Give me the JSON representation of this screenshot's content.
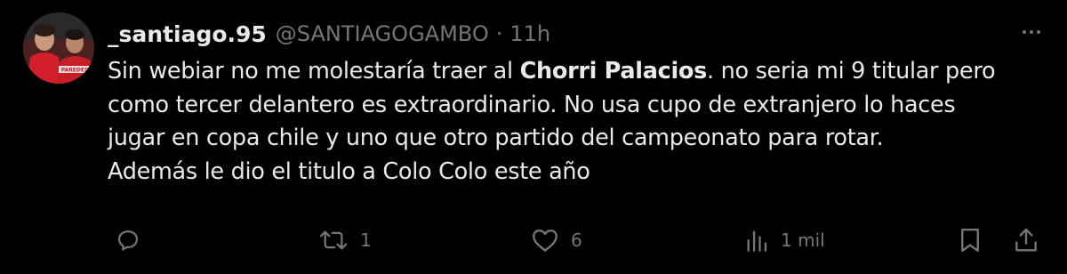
{
  "tweet": {
    "display_name": "_santiago.95",
    "handle": "@SANTIAGOGAMBO",
    "separator": "·",
    "time": "11h",
    "body": {
      "line1_before": "Sin webiar no me molestaría traer al ",
      "line1_bold": "Chorri Palacios",
      "line1_after": ". no seria mi 9 titular pero",
      "line2": "como tercer delantero es extraordinario. No usa cupo de extranjero lo haces",
      "line3": "jugar en copa chile y uno que otro partido del campeonato para rotar.",
      "line4": "Además le dio el titulo a Colo Colo este año"
    },
    "avatar_text": "PAREDES"
  },
  "actions": {
    "reply_icon": "reply-icon",
    "retweet_icon": "retweet-icon",
    "retweet_count": "1",
    "like_icon": "heart-icon",
    "like_count": "6",
    "views_icon": "views-icon",
    "views_count": "1 mil",
    "bookmark_icon": "bookmark-icon",
    "share_icon": "share-icon"
  },
  "colors": {
    "background": "#000000",
    "primary_text": "#e7e9ea",
    "secondary_text": "#71767b"
  }
}
